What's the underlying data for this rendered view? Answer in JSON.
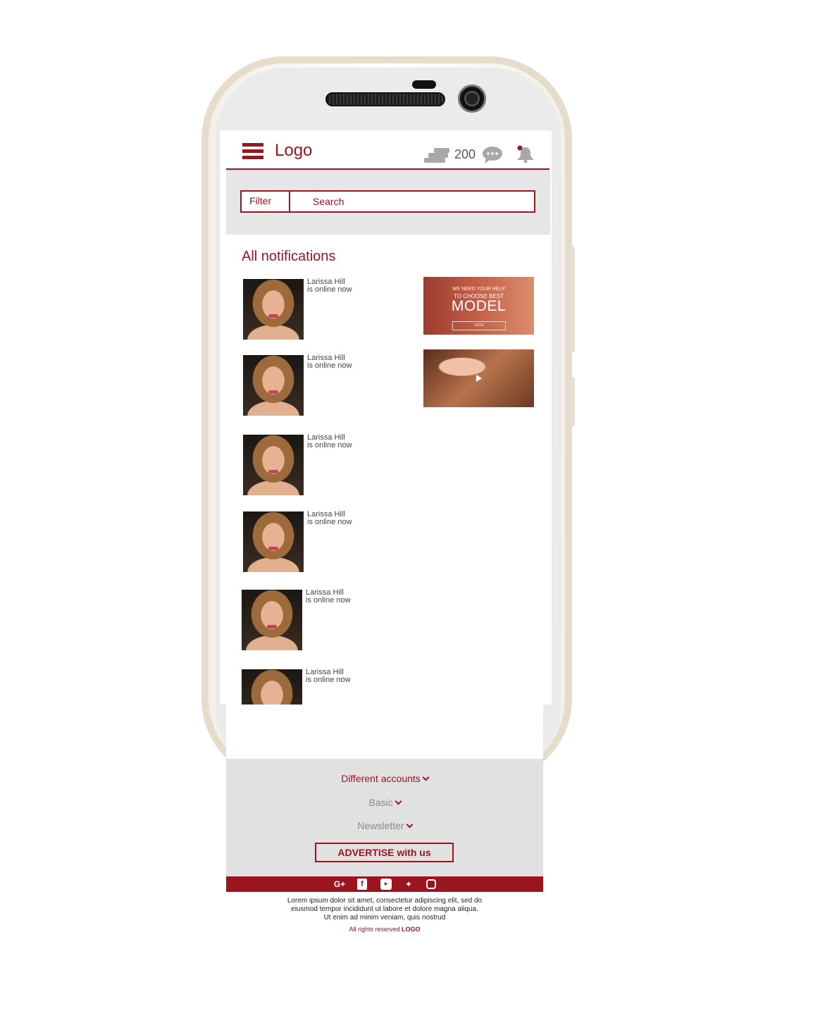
{
  "header": {
    "logo": "Logo",
    "coin_count": "200"
  },
  "search": {
    "filter_label": "Filter",
    "placeholder": "Search"
  },
  "notifications": {
    "title": "All notifications",
    "items": [
      {
        "name": "Larissa Hill",
        "status": "is online now"
      },
      {
        "name": "Larissa Hill",
        "status": "is online now"
      },
      {
        "name": "Larissa Hill",
        "status": "is online now"
      },
      {
        "name": "Larissa Hill",
        "status": "is online now"
      },
      {
        "name": "Larissa Hill",
        "status": "is online now"
      },
      {
        "name": "Larissa Hill",
        "status": "is online now"
      }
    ]
  },
  "banner": {
    "line1": "WE NEED YOUR HELP",
    "line2": "TO CHOOSE BEST",
    "big": "MODEL",
    "button": "VOTE"
  },
  "footer": {
    "links": [
      "Different accounts",
      "Basic",
      "Newsletter"
    ],
    "advertise": "ADVERTISE with us",
    "social": [
      "google-plus-icon",
      "facebook-icon",
      "youtube-icon",
      "twitter-icon",
      "instagram-icon"
    ],
    "lorem_line1": "Lorem ipsum dolor sit amet, consectetur adipiscing elit, sed do",
    "lorem_line2": "eiusmod tempor incididunt ut labore et dolore magna aliqua.",
    "lorem_line3": "Ut enim ad minim veniam, quis nostrud",
    "rights_text": "All rights reserved",
    "rights_logo": "LOGO"
  },
  "colors": {
    "accent": "#9b1520",
    "panel": "#e1e1e1"
  }
}
